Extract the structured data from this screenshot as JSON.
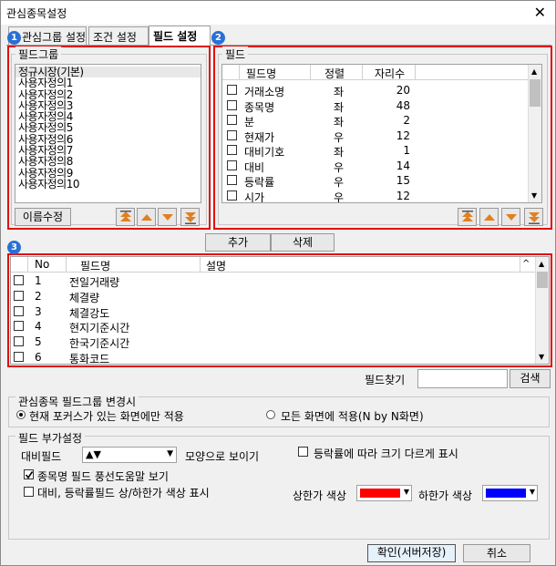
{
  "window": {
    "title": "관심종목설정"
  },
  "tabs": [
    {
      "label": "관심그룹 설정"
    },
    {
      "label": "조건 설정"
    },
    {
      "label": "필드 설정"
    }
  ],
  "badges": [
    "1",
    "2",
    "3"
  ],
  "field_group": {
    "label": "필드그룹",
    "items": [
      "정규시장(기본)",
      "사용자정의1",
      "사용자정의2",
      "사용자정의3",
      "사용자정의4",
      "사용자정의5",
      "사용자정의6",
      "사용자정의7",
      "사용자정의8",
      "사용자정의9",
      "사용자정의10"
    ],
    "rename_label": "이름수정"
  },
  "fields": {
    "label": "필드",
    "columns": [
      "필드명",
      "정렬",
      "자리수"
    ],
    "rows": [
      {
        "name": "거래소명",
        "align": "좌",
        "digits": "20"
      },
      {
        "name": "종목명",
        "align": "좌",
        "digits": "48"
      },
      {
        "name": "분",
        "align": "좌",
        "digits": "2"
      },
      {
        "name": "현재가",
        "align": "우",
        "digits": "12"
      },
      {
        "name": "대비기호",
        "align": "좌",
        "digits": "1"
      },
      {
        "name": "대비",
        "align": "우",
        "digits": "14"
      },
      {
        "name": "등락률",
        "align": "우",
        "digits": "15"
      },
      {
        "name": "시가",
        "align": "우",
        "digits": "12"
      }
    ]
  },
  "mid_buttons": {
    "add": "추가",
    "delete": "삭제"
  },
  "selected": {
    "columns": [
      "No",
      "필드명",
      "설명"
    ],
    "rows": [
      {
        "no": "1",
        "name": "전일거래량"
      },
      {
        "no": "2",
        "name": "체결량"
      },
      {
        "no": "3",
        "name": "체결강도"
      },
      {
        "no": "4",
        "name": "현지기준시간"
      },
      {
        "no": "5",
        "name": "한국기준시간"
      },
      {
        "no": "6",
        "name": "통화코드"
      }
    ]
  },
  "find": {
    "label": "필드찾기",
    "value": "",
    "button": "검색"
  },
  "apply_group": {
    "label": "관심종목 필드그룹 변경시",
    "opt1": "현재 포커스가 있는 화면에만 적용",
    "opt2": "모든 화면에 적용(N by N화면)"
  },
  "extra": {
    "label": "필드 부가설정",
    "compare_label": "대비필드",
    "compare_value": "▲▼",
    "compare_suffix": "모양으로 보이기",
    "size_by_rate": "등락률에 따라 크기 다르게 표시",
    "tooltip": "종목명 필드 풍선도움말 보기",
    "color_show": "대비, 등락률필드 상/하한가 색상 표시",
    "upper_label": "상한가 색상",
    "upper_color": "#ff0000",
    "lower_label": "하한가 색상",
    "lower_color": "#0000ff"
  },
  "footer": {
    "ok": "확인(서버저장)",
    "cancel": "취소"
  }
}
